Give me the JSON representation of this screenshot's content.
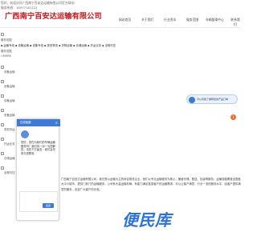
{
  "topbar": {
    "greet": "您好，欢迎访问广西南宁百安达运输有限公司官方网站!",
    "line2": "服务热线：18977181122"
  },
  "brand": {
    "name": "广西南宁百安达运输有限公司",
    "tel_label": "",
    "tel": "18977181122"
  },
  "nav": [
    "网站首页",
    "关于我们",
    "行业资讯",
    "服务范围",
    "车辆整車中心",
    "联系我们"
  ],
  "side": {
    "service_cat": "服务范围",
    "cat_list": "▪ 运输专线 ▪ 设备运输 ▪ 设备专线 ▪ 零担物流 ▪ 货物运输 ▪ 仓储运输 ▪ 托运业务 ▪ 全程可控",
    "scope": "服务范围",
    "more": ">MORE",
    "icons": [
      "设备运输",
      "设备运输",
      "设备运输",
      "设备运输",
      "零担货运",
      "托运业务",
      "仓储运输",
      "全程可控"
    ]
  },
  "float": {
    "label": "可以问我了推荐您的产品订单"
  },
  "badge": "1",
  "chat": {
    "title": "在线客服",
    "close": "×",
    "msg": "您好，您在为我们的车辆运输服务吗？我们将一对一为您解答，请在下方留言，我们会尽快与您联系。",
    "send": "发送"
  },
  "intro": "广西南宁百安达运输有限公司，我们是以运输为主的综合物流企业，我们以专业运输服务为核心，兼营仓储、配送、包装等服务。运输线路覆盖全国各大中小城市，提供门到门的运输服务，公司有大量运输车辆，有能力满足各类客户的运输需求，可以让客户满意，行业一流的服务水平，给客户提供满意的服务，欢迎广大客户的光临。",
  "watermark": "便民库"
}
